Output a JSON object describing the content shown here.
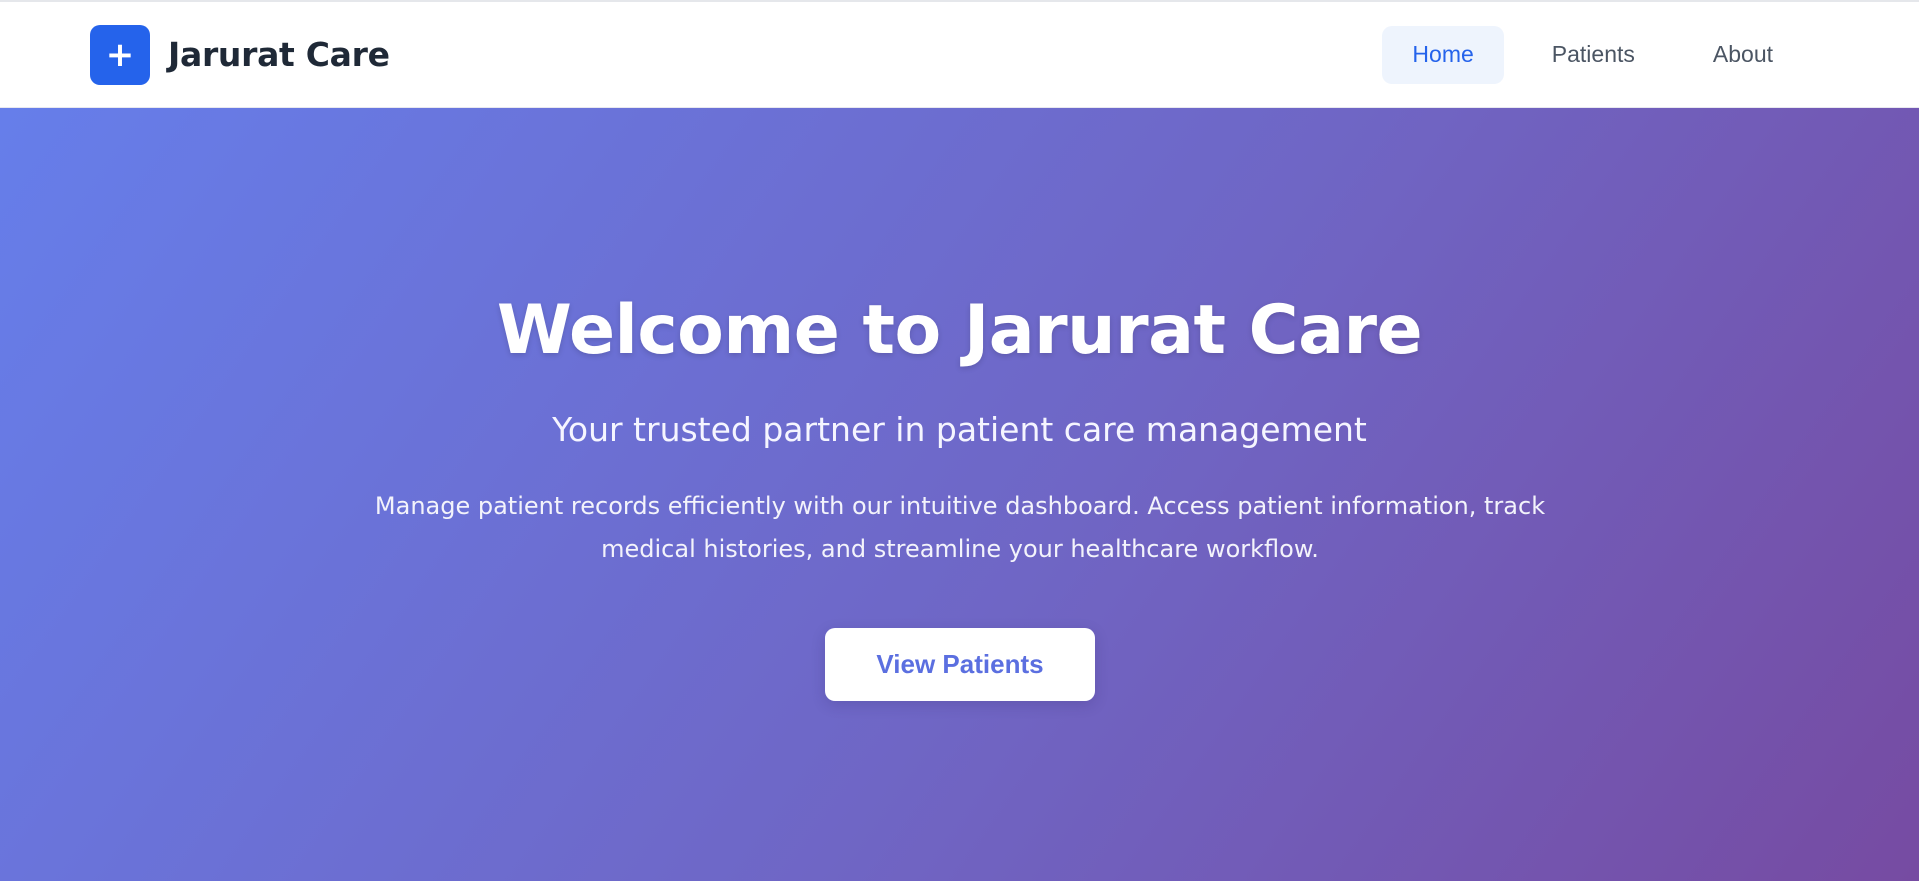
{
  "brand": {
    "logo_icon": "+",
    "name": "Jarurat Care",
    "accent_color": "#2563eb"
  },
  "nav": {
    "items": [
      {
        "label": "Home",
        "active": true
      },
      {
        "label": "Patients",
        "active": false
      },
      {
        "label": "About",
        "active": false
      }
    ]
  },
  "hero": {
    "title": "Welcome to Jarurat Care",
    "subtitle": "Your trusted partner in patient care management",
    "description": "Manage patient records efficiently with our intuitive dashboard. Access patient information, track medical histories, and streamline your healthcare workflow.",
    "cta_label": "View Patients",
    "gradient_start": "#667eea",
    "gradient_end": "#764ba2"
  }
}
